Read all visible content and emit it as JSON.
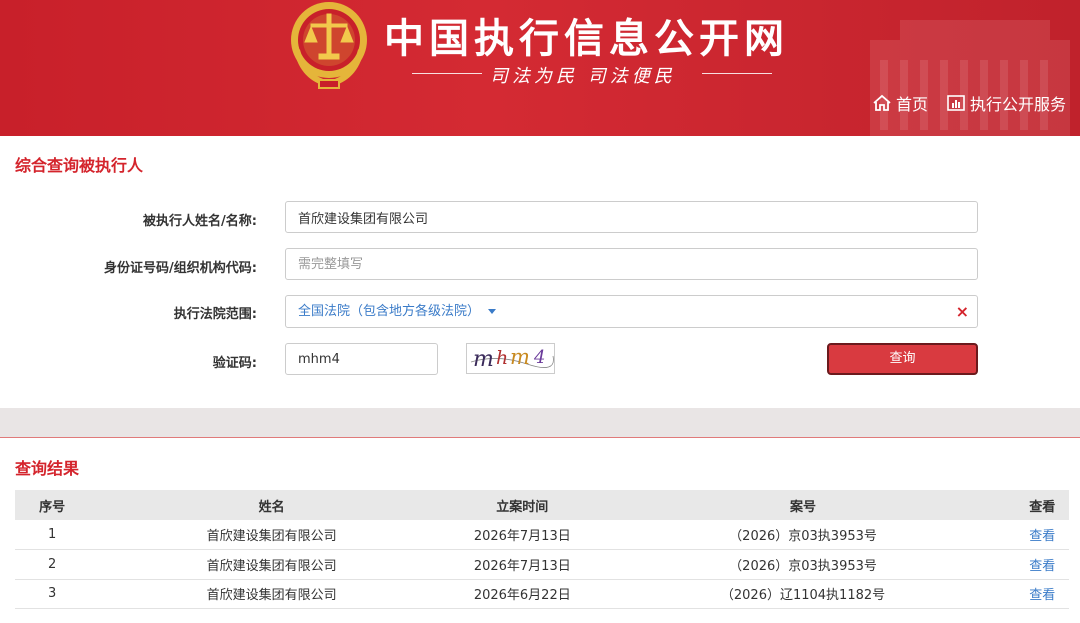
{
  "header": {
    "site_title": "中国执行信息公开网",
    "slogan": "司法为民  司法便民",
    "nav": [
      {
        "label": "首页",
        "icon": "home-icon"
      },
      {
        "label": "执行公开服务",
        "icon": "chart-icon"
      }
    ]
  },
  "query": {
    "section_title": "综合查询被执行人",
    "name_label": "被执行人姓名/名称:",
    "name_value": "首欣建设集团有限公司",
    "id_label": "身份证号码/组织机构代码:",
    "id_placeholder": "需完整填写",
    "court_label": "执行法院范围:",
    "court_value": "全国法院（包含地方各级法院）",
    "clear_icon": "×",
    "captcha_label": "验证码:",
    "captcha_value": "mhm4",
    "captcha_image_text": "mhm4",
    "query_button": "查询"
  },
  "results": {
    "section_title": "查询结果",
    "columns": [
      "序号",
      "姓名",
      "立案时间",
      "案号",
      "查看"
    ],
    "rows": [
      {
        "index": "1",
        "name": "首欣建设集团有限公司",
        "date": "2026年7月13日",
        "case_no": "（2026）京03执3953号",
        "action": "查看"
      },
      {
        "index": "2",
        "name": "首欣建设集团有限公司",
        "date": "2026年7月13日",
        "case_no": "（2026）京03执3953号",
        "action": "查看"
      },
      {
        "index": "3",
        "name": "首欣建设集团有限公司",
        "date": "2026年6月22日",
        "case_no": "（2026）辽1104执1182号",
        "action": "查看"
      }
    ]
  },
  "colors": {
    "brand_red": "#d4242c",
    "link_blue": "#3a7bc8",
    "button_red": "#d93a40"
  }
}
